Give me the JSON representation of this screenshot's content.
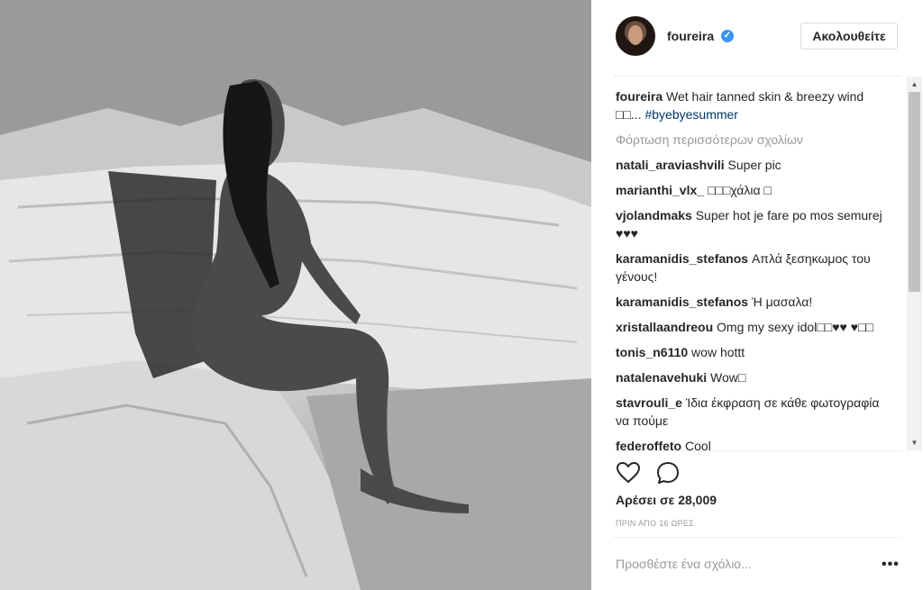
{
  "post": {
    "image_alt": "black and white photo of a woman sitting on beach rocks"
  },
  "header": {
    "username": "foureira",
    "verified_icon": "verified-badge-icon",
    "follow_label": "Ακολουθείτε"
  },
  "caption": {
    "user": "foureira",
    "text": "Wet hair tanned skin & breezy wind □□... ",
    "hashtag": "#byebyesummer"
  },
  "load_more": "Φόρτωση περισσότερων σχολίων",
  "comments": [
    {
      "user": "natali_araviashvili",
      "text": "Super pic"
    },
    {
      "user": "marianthi_vlx_",
      "text": "□□□χάλια □"
    },
    {
      "user": "vjolandmaks",
      "text": "Super hot je fare po mos semurej ♥♥♥"
    },
    {
      "user": "karamanidis_stefanos",
      "text": "Απλά ξεσηκωμος του γένους!"
    },
    {
      "user": "karamanidis_stefanos",
      "text": "Ή μασαλα!"
    },
    {
      "user": "xristallaandreou",
      "text": "Omg my sexy idol□□♥♥ ♥□□"
    },
    {
      "user": "tonis_n6110",
      "text": "wow hottt"
    },
    {
      "user": "natalenavehuki",
      "text": "Wow□"
    },
    {
      "user": "stavrouli_e",
      "text": "Ίδια έκφραση σε κάθε φωτογραφία να πούμε"
    },
    {
      "user": "federoffeto",
      "text": "Cool"
    }
  ],
  "actions": {
    "like_icon": "heart-icon",
    "comment_icon": "comment-bubble-icon",
    "more_icon": "more-options-icon"
  },
  "likes": "Αρέσει σε 28,009",
  "timestamp": "ΠΡΙΝ ΑΠΟ 16 ΩΡΕΣ",
  "add_comment_placeholder": "Προσθέστε ένα σχόλιο...",
  "colors": {
    "verified": "#3897f0",
    "hashtag": "#003569",
    "muted": "#999999",
    "text": "#262626"
  }
}
